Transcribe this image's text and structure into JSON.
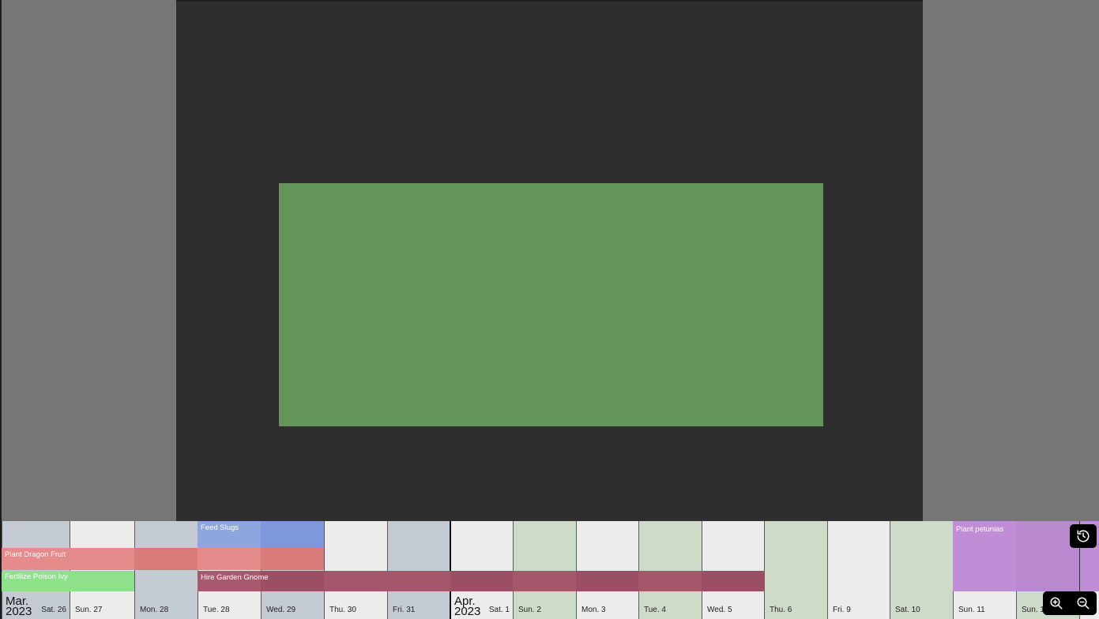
{
  "timeline": {
    "months": [
      {
        "label_line1": "Mar.",
        "label_line2": "2023"
      },
      {
        "label_line1": "Apr.",
        "label_line2": "2023"
      }
    ],
    "days": [
      {
        "label": "Sat. 26"
      },
      {
        "label": "Sun. 27"
      },
      {
        "label": "Mon. 28"
      },
      {
        "label": "Tue. 28"
      },
      {
        "label": "Wed. 29"
      },
      {
        "label": "Thu. 30"
      },
      {
        "label": "Fri. 31"
      },
      {
        "label": "Sat. 1"
      },
      {
        "label": "Sun. 2"
      },
      {
        "label": "Mon. 3"
      },
      {
        "label": "Tue. 4"
      },
      {
        "label": "Wed. 5"
      },
      {
        "label": "Thu. 6"
      },
      {
        "label": "Fri. 9"
      },
      {
        "label": "Sat. 10"
      },
      {
        "label": "Sun. 11"
      },
      {
        "label": "Sun. 12"
      }
    ],
    "events": [
      {
        "title": "Plant Dragon Fruit",
        "color": "#e58b8b"
      },
      {
        "title": "Fertilize Poison Ivy",
        "color": "#8fe08b"
      },
      {
        "title": "Feed Slugs",
        "color": "#8ea6e0"
      },
      {
        "title": "Hire Garden Gnome",
        "color": "#9b4f64"
      },
      {
        "title": "Plant petunias",
        "color": "#c08ed6"
      }
    ]
  },
  "icons": {
    "history": "history-icon",
    "zoom_in": "zoom-in-icon",
    "zoom_out": "zoom-out-icon"
  }
}
